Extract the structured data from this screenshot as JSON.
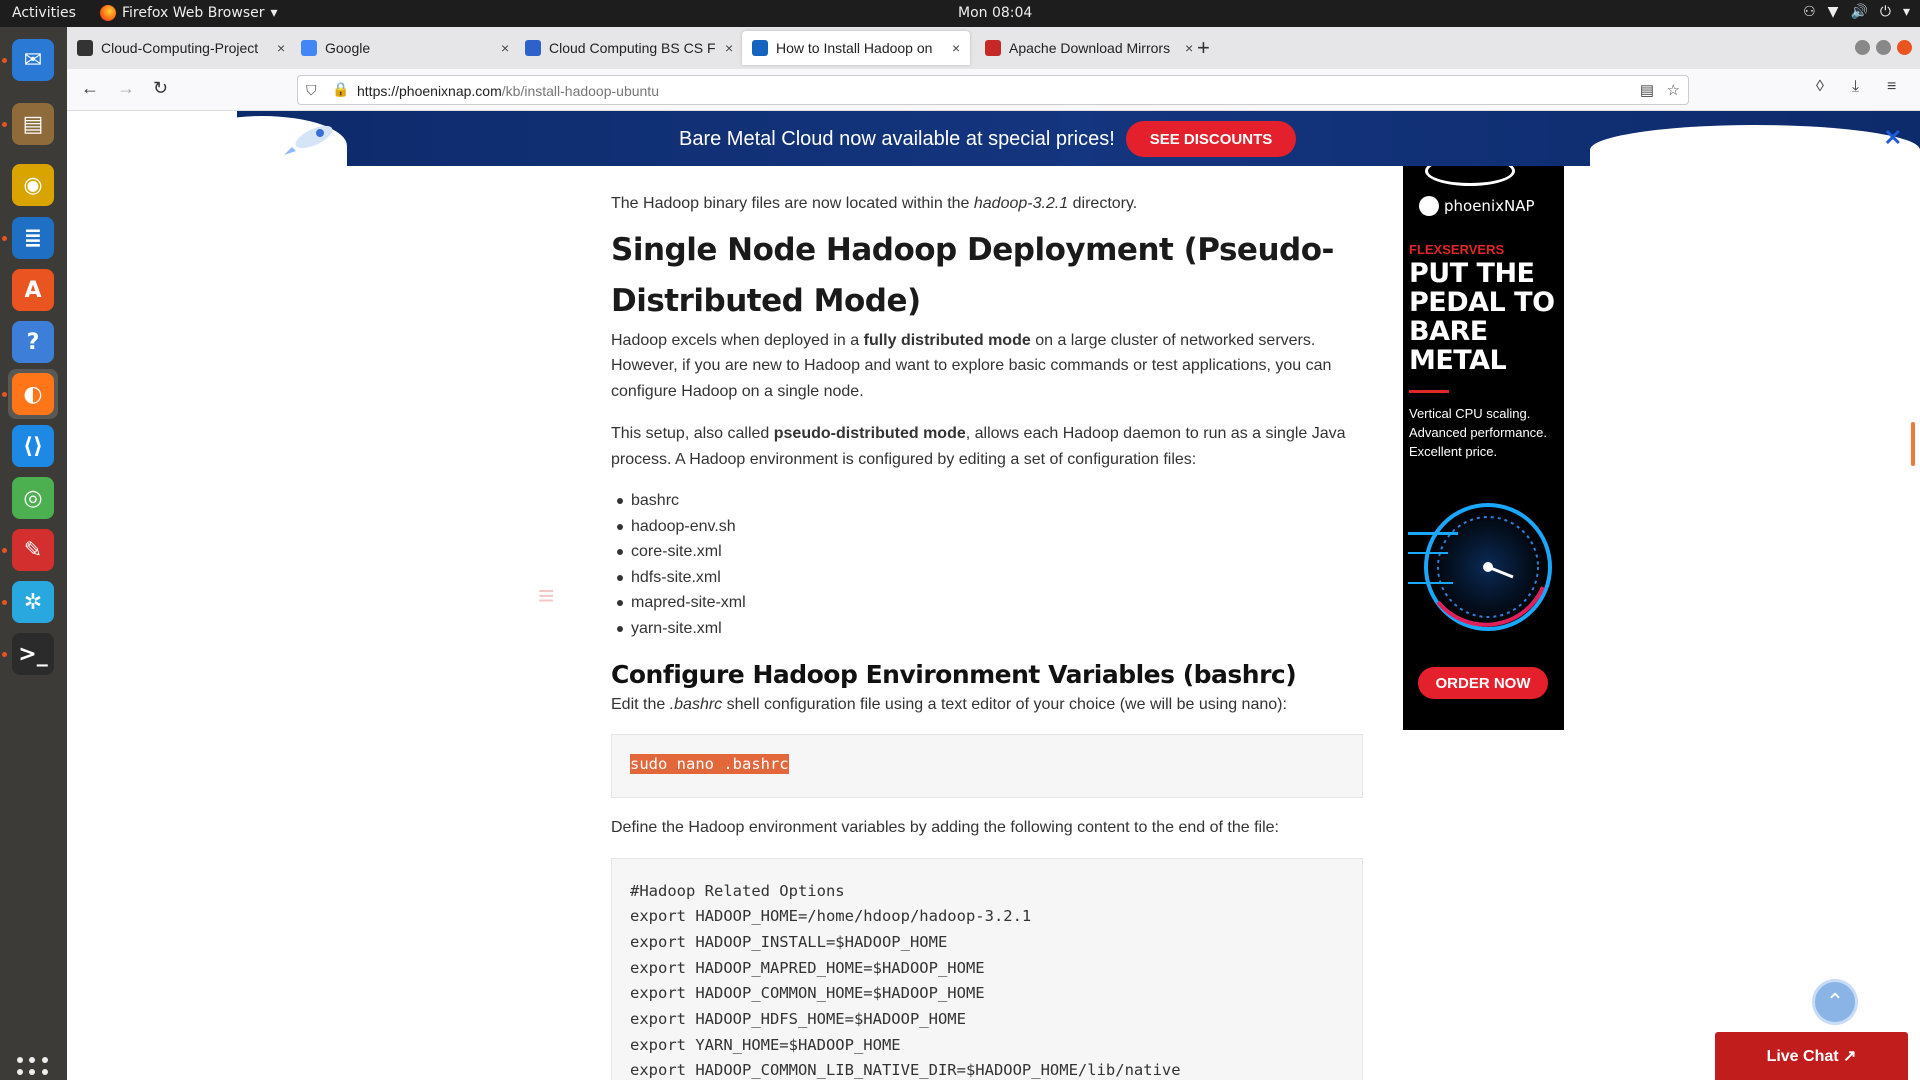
{
  "topbar": {
    "activities": "Activities",
    "app_name": "Firefox Web Browser",
    "app_menu_arrow": "▾",
    "clock": "Mon 08:04",
    "tray": [
      "⚇",
      "▼",
      "🔊",
      "⏻",
      "▾"
    ]
  },
  "dock": {
    "items": [
      {
        "name": "thunderbird",
        "color": "#2a79d4",
        "glyph": "✉"
      },
      {
        "name": "files",
        "color": "#8f6a3a",
        "glyph": "▤"
      },
      {
        "name": "rhythmbox",
        "color": "#d9a400",
        "glyph": "◉"
      },
      {
        "name": "libreoffice-writer",
        "color": "#1f6fc5",
        "glyph": "≣"
      },
      {
        "name": "ubuntu-software",
        "color": "#e95420",
        "glyph": "A"
      },
      {
        "name": "help",
        "color": "#3d7fd8",
        "glyph": "?"
      },
      {
        "name": "firefox",
        "color": "#ff7518",
        "glyph": "◐"
      },
      {
        "name": "vscode",
        "color": "#1e88e5",
        "glyph": "⟨⟩"
      },
      {
        "name": "chrome",
        "color": "#4caf50",
        "glyph": "◎"
      },
      {
        "name": "evince",
        "color": "#d32f2f",
        "glyph": "✎"
      },
      {
        "name": "settings-app",
        "color": "#29a8e0",
        "glyph": "✲"
      },
      {
        "name": "terminal",
        "color": "#2b2b2b",
        "glyph": ">_"
      }
    ]
  },
  "tabs": [
    {
      "label": "Cloud-Computing-Project",
      "close": "×",
      "favicon_color": "#333333"
    },
    {
      "label": "Google",
      "close": "×",
      "favicon_color": "#4285f4"
    },
    {
      "label": "Cloud Computing BS CS F",
      "close": "×",
      "favicon_color": "#2f62c9"
    },
    {
      "label": "How to Install Hadoop on",
      "close": "×",
      "favicon_color": "#1565c0"
    },
    {
      "label": "Apache Download Mirrors",
      "close": "×",
      "favicon_color": "#c62828"
    }
  ],
  "newtab": "+",
  "nav": {
    "back": "←",
    "forward": "→",
    "reload": "↻",
    "url_domain": "https://phoenixnap.com",
    "url_path": "/kb/install-hadoop-ubuntu",
    "shield": "⛉",
    "lock": "🔒",
    "reader": "▤",
    "bookmark": "☆",
    "pocket": "◊",
    "downloads": "⤓",
    "menu": "≡"
  },
  "banner": {
    "message": "Bare Metal Cloud now available at special prices!",
    "cta": "SEE DISCOUNTS",
    "close": "✕"
  },
  "article": {
    "p_located_pre": "The Hadoop binary files are now located within the ",
    "p_located_em": "hadoop-3.2.1",
    "p_located_post": " directory.",
    "h2": "Single Node Hadoop Deployment (Pseudo-Distributed Mode)",
    "p1_pre": "Hadoop excels when deployed in a ",
    "p1_bold": "fully distributed mode",
    "p1_post": " on a large cluster of networked servers. However, if you are new to Hadoop and want to explore basic commands or test applications, you can configure Hadoop on a single node.",
    "p2_pre": "This setup, also called ",
    "p2_bold": "pseudo-distributed mode",
    "p2_post": ", allows each Hadoop daemon to run as a single Java process. A Hadoop environment is configured by editing a set of configuration files:",
    "files": [
      "bashrc",
      "hadoop-env.sh",
      "core-site.xml",
      "hdfs-site.xml",
      "mapred-site-xml",
      "yarn-site.xml"
    ],
    "h3": "Configure Hadoop Environment Variables (bashrc)",
    "p3_pre": "Edit the ",
    "p3_em": ".bashrc",
    "p3_post": " shell configuration file using a text editor of your choice (we will be using nano):",
    "cmd": "sudo nano .bashrc",
    "p4": "Define the Hadoop environment variables by adding the following content to the end of the file:",
    "code_lines": [
      "#Hadoop Related Options",
      "export HADOOP_HOME=/home/hdoop/hadoop-3.2.1",
      "export HADOOP_INSTALL=$HADOOP_HOME",
      "export HADOOP_MAPRED_HOME=$HADOOP_HOME",
      "export HADOOP_COMMON_HOME=$HADOOP_HOME",
      "export HADOOP_HDFS_HOME=$HADOOP_HOME",
      "export YARN_HOME=$HADOOP_HOME",
      "export HADOOP_COMMON_LIB_NATIVE_DIR=$HADOOP_HOME/lib/native"
    ],
    "menu_glyph": "≡"
  },
  "ad": {
    "brand": "phoenixNAP",
    "tag": "FLEXSERVERS",
    "headline": "PUT THE PEDAL TO BARE METAL",
    "sub": "Vertical CPU scaling. Advanced performance. Excellent price.",
    "cta": "ORDER NOW"
  },
  "totop": "⌃",
  "livechat": "Live Chat ↗"
}
